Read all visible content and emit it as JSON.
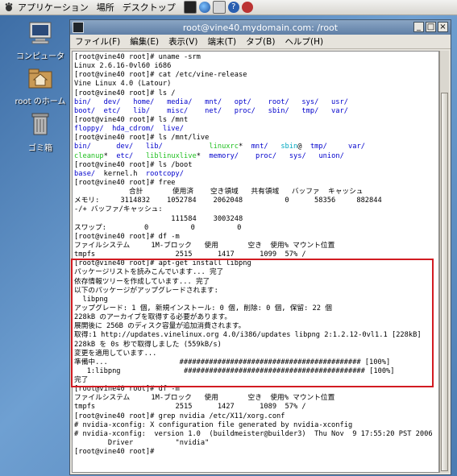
{
  "panel": {
    "applications": "アプリケーション",
    "places": "場所",
    "desktop": "デスクトップ"
  },
  "desktop_icons": [
    {
      "label": "コンピュータ"
    },
    {
      "label": "root のホーム"
    },
    {
      "label": "ゴミ箱"
    }
  ],
  "window": {
    "title": "root@vine40.mydomain.com: /root",
    "menu": [
      "ファイル(F)",
      "編集(E)",
      "表示(V)",
      "端末(T)",
      "タブ(B)",
      "ヘルプ(H)"
    ]
  },
  "terminal": {
    "lines": [
      [
        {
          "t": "[root@vine40 root]# uname -srm"
        }
      ],
      [
        {
          "t": "Linux 2.6.16-0vl60 i686"
        }
      ],
      [
        {
          "t": "[root@vine40 root]# cat /etc/vine-release"
        }
      ],
      [
        {
          "t": "Vine Linux 4.0 (Latour)"
        }
      ],
      [
        {
          "t": "[root@vine40 root]# ls /"
        }
      ],
      [
        {
          "t": "bin/   dev/   home/   media/   mnt/   opt/    root/   sys/   usr/",
          "c": "blue"
        }
      ],
      [
        {
          "t": "boot/  etc/   lib/    misc/    net/   proc/   sbin/   tmp/   var/",
          "c": "blue"
        }
      ],
      [
        {
          "t": "[root@vine40 root]# ls /mnt"
        }
      ],
      [
        {
          "t": "floppy/  hda_cdrom/  live/",
          "c": "blue"
        }
      ],
      [
        {
          "t": "[root@vine40 root]# ls /mnt/live"
        }
      ],
      [
        {
          "t": "bin/      dev/   lib/           ",
          "c": "blue"
        },
        {
          "t": "linuxrc",
          "c": "green"
        },
        {
          "t": "*  "
        },
        {
          "t": "mnt/",
          "c": "blue"
        },
        {
          "t": "   "
        },
        {
          "t": "sbin",
          "c": "cyan"
        },
        {
          "t": "@  "
        },
        {
          "t": "tmp/",
          "c": "blue"
        },
        {
          "t": "     "
        },
        {
          "t": "var/",
          "c": "blue"
        }
      ],
      [
        {
          "t": "cleanup",
          "c": "green"
        },
        {
          "t": "*  "
        },
        {
          "t": "etc/",
          "c": "blue"
        },
        {
          "t": "   "
        },
        {
          "t": "liblinuxlive",
          "c": "green"
        },
        {
          "t": "*  "
        },
        {
          "t": "memory/",
          "c": "blue"
        },
        {
          "t": "    "
        },
        {
          "t": "proc/",
          "c": "blue"
        },
        {
          "t": "   "
        },
        {
          "t": "sys/",
          "c": "blue"
        },
        {
          "t": "   "
        },
        {
          "t": "union/",
          "c": "blue"
        }
      ],
      [
        {
          "t": "[root@vine40 root]# ls /boot"
        }
      ],
      [
        {
          "t": "base/",
          "c": "blue"
        },
        {
          "t": "  kernel.h  "
        },
        {
          "t": "rootcopy/",
          "c": "blue"
        }
      ],
      [
        {
          "t": "[root@vine40 root]# free"
        }
      ],
      [
        {
          "t": "             合計       使用済    空き領域   共有領域   バッファ  キャッシュ"
        }
      ],
      [
        {
          "t": "メモリ:     3114832    1052784    2062048          0      58356     882844"
        }
      ],
      [
        {
          "t": "-/+ バッファ/キャッシュ:"
        }
      ],
      [
        {
          "t": "                       111584    3003248"
        }
      ],
      [
        {
          "t": "スワップ:         0          0          0"
        }
      ],
      [
        {
          "t": "[root@vine40 root]# df -m"
        }
      ],
      [
        {
          "t": "ファイルシステム     1M-ブロック   使用       空き  使用% マウント位置"
        }
      ],
      [
        {
          "t": "tmpfs                   2515      1417      1099  57% /"
        }
      ],
      [
        {
          "t": "[root@vine40 root]# apt-get install libpng"
        }
      ],
      [
        {
          "t": "パッケージリストを読みこんでいます... 完了"
        }
      ],
      [
        {
          "t": "依存情報ツリーを作成しています... 完了"
        }
      ],
      [
        {
          "t": "以下のパッケージがアップグレードされます:"
        }
      ],
      [
        {
          "t": "  libpng"
        }
      ],
      [
        {
          "t": "アップグレード: 1 個, 新規インストール: 0 個, 削除: 0 個, 保留: 22 個"
        }
      ],
      [
        {
          "t": "228kB のアーカイブを取得する必要があります。"
        }
      ],
      [
        {
          "t": "展開後に 256B のディスク容量が追加消費されます。"
        }
      ],
      [
        {
          "t": "取得:1 http://updates.vinelinux.org 4.0/i386/updates libpng 2:1.2.12-0vl1.1 [228kB]"
        }
      ],
      [
        {
          "t": "228kB を 0s 秒で取得しました (559kB/s)"
        }
      ],
      [
        {
          "t": "変更を適用しています..."
        }
      ],
      [
        {
          "t": "準備中...                 ########################################### [100%]"
        }
      ],
      [
        {
          "t": "   1:libpng               ########################################### [100%]"
        }
      ],
      [
        {
          "t": "完了"
        }
      ],
      [
        {
          "t": "[root@vine40 root]# df -m"
        }
      ],
      [
        {
          "t": "ファイルシステム     1M-ブロック   使用       空き  使用% マウント位置"
        }
      ],
      [
        {
          "t": "tmpfs                   2515      1427      1089  57% /"
        }
      ],
      [
        {
          "t": "[root@vine40 root]# grep nvidia /etc/X11/xorg.conf"
        }
      ],
      [
        {
          "t": "# nvidia-xconfig: X configuration file generated by nvidia-xconfig"
        }
      ],
      [
        {
          "t": "# nvidia-xconfig:  version 1.0  (buildmeister@builder3)  Thu Nov  9 17:55:20 PST 2006"
        }
      ],
      [
        {
          "t": "        Driver          \"nvidia\""
        }
      ],
      [
        {
          "t": "[root@vine40 root]# "
        }
      ]
    ]
  },
  "colors": {
    "dir": "#0000cc",
    "exec": "#20c020",
    "link": "#00a8c0",
    "highlight": "#d21b22"
  }
}
